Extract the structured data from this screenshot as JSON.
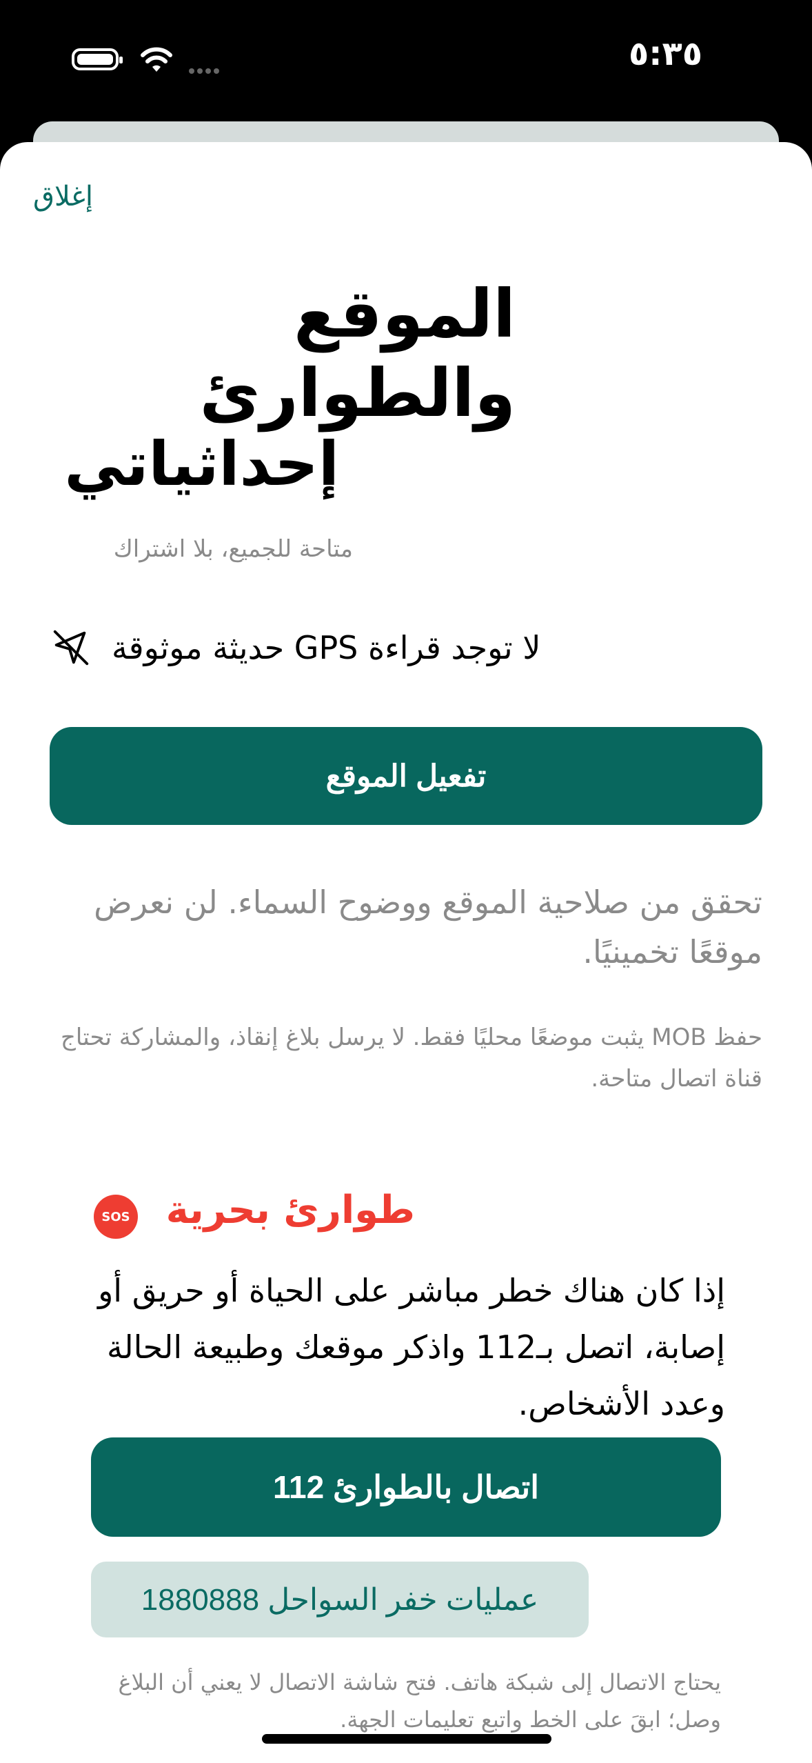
{
  "status_bar": {
    "time": "٥:٣٥"
  },
  "header": {
    "close_label": "إغلاق",
    "title": "الموقع والطوارئ"
  },
  "coordinates": {
    "title": "إحداثياتي",
    "subtitle": "متاحة للجميع، بلا اشتراك",
    "gps_status": "لا توجد قراءة GPS حديثة موثوقة",
    "gps_icon": "location-off-icon",
    "enable_button": "تفعيل الموقع",
    "hint": "تحقق من صلاحية الموقع ووضوح السماء. لن نعرض موقعًا تخمينيًا.",
    "note": "حفظ MOB يثبت موضعًا محليًا فقط. لا يرسل بلاغ إنقاذ، والمشاركة تحتاج قناة اتصال متاحة."
  },
  "emergency": {
    "icon_label": "SOS",
    "title": "طوارئ بحرية",
    "body": "إذا كان هناك خطر مباشر على الحياة أو حريق أو إصابة، اتصل بـ112 واذكر موقعك وطبيعة الحالة وعدد الأشخاص.",
    "call_button": "اتصال بالطوارئ 112",
    "coast_guard_button": "عمليات خفر السواحل 1880888",
    "disclaimer": "يحتاج الاتصال إلى شبكة هاتف. فتح شاشة الاتصال لا يعني أن البلاغ وصل؛ ابقَ على الخط واتبع تعليمات الجهة."
  },
  "colors": {
    "accent": "#08675e",
    "danger": "#ee3d32",
    "secondary_bg": "#d1e2df"
  }
}
